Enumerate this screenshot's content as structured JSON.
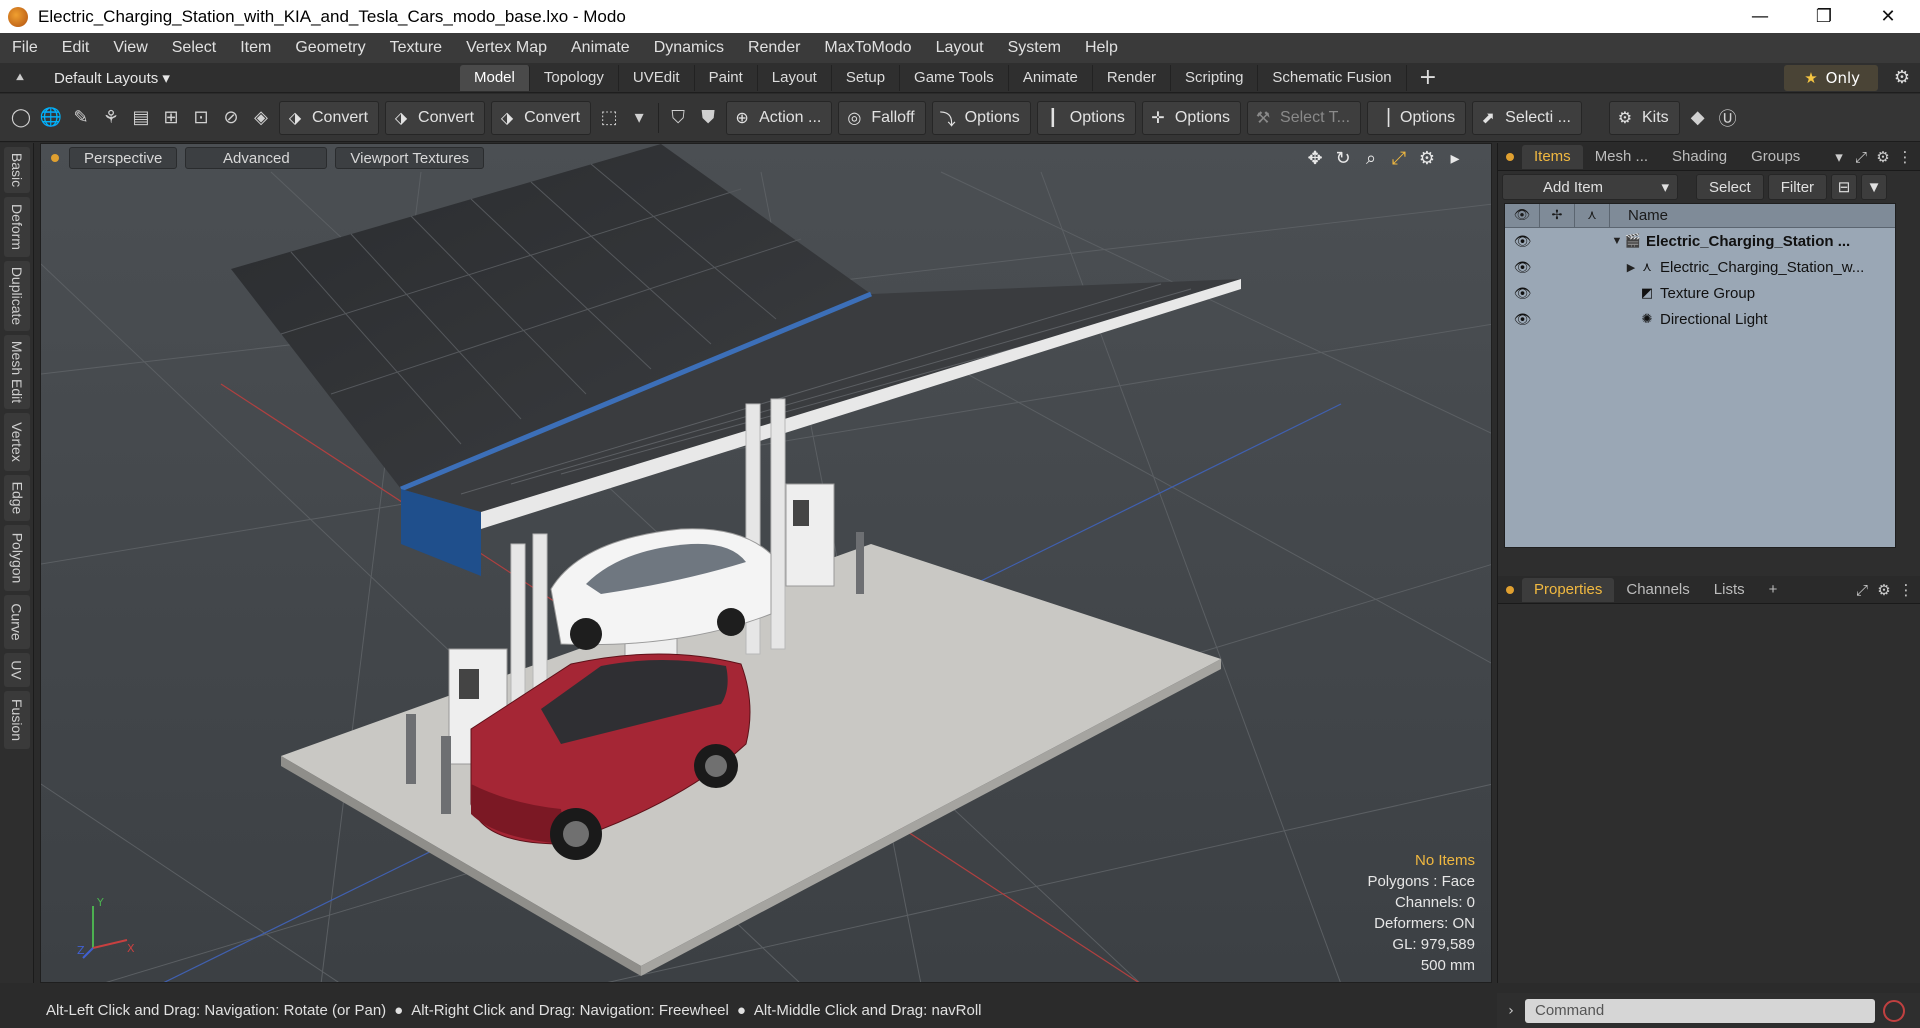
{
  "window": {
    "title": "Electric_Charging_Station_with_KIA_and_Tesla_Cars_modo_base.lxo - Modo",
    "minimize": "—",
    "maximize": "❐",
    "close": "✕"
  },
  "menu": [
    "File",
    "Edit",
    "View",
    "Select",
    "Item",
    "Geometry",
    "Texture",
    "Vertex Map",
    "Animate",
    "Dynamics",
    "Render",
    "MaxToModo",
    "Layout",
    "System",
    "Help"
  ],
  "layoutbar": {
    "layouts_label": "Default Layouts ▾",
    "tabs": [
      "Model",
      "Topology",
      "UVEdit",
      "Paint",
      "Layout",
      "Setup",
      "Game Tools",
      "Animate",
      "Render",
      "Scripting",
      "Schematic Fusion"
    ],
    "active_tab": "Model",
    "only_label": "Only"
  },
  "toolbar": {
    "convert_1": "Convert",
    "convert_2": "Convert",
    "convert_3": "Convert",
    "action": "Action ...",
    "falloff": "Falloff",
    "options_1": "Options",
    "options_2": "Options",
    "options_3": "Options",
    "select_t": "Select T...",
    "options_4": "Options",
    "selecti": "Selecti ...",
    "kits": "Kits"
  },
  "left_tabs": [
    "Basic",
    "Deform",
    "Duplicate",
    "Mesh Edit",
    "Vertex",
    "Edge",
    "Polygon",
    "Curve",
    "UV",
    "Fusion"
  ],
  "viewport": {
    "view_mode": "Perspective",
    "shading": "Advanced",
    "textures": "Viewport Textures",
    "info": {
      "selection": "No Items",
      "polygons": "Polygons : Face",
      "channels": "Channels: 0",
      "deformers": "Deformers: ON",
      "gl": "GL: 979,589",
      "unit": "500 mm"
    },
    "gizmo": {
      "x": "X",
      "y": "Y",
      "z": "Z"
    }
  },
  "items_panel": {
    "tabs": [
      "Items",
      "Mesh ...",
      "Shading",
      "Groups"
    ],
    "active_tab": "Items",
    "add_item": "Add Item",
    "select": "Select",
    "filter": "Filter",
    "name_header": "Name",
    "rows": [
      {
        "label": "Electric_Charging_Station ...",
        "icon": "scene-icon",
        "bold": true,
        "indent": 0,
        "expander": "▼"
      },
      {
        "label": "Electric_Charging_Station_w...",
        "icon": "mesh-icon",
        "bold": false,
        "indent": 1,
        "expander": "▶"
      },
      {
        "label": "Texture Group",
        "icon": "texture-group-icon",
        "bold": false,
        "indent": 1,
        "expander": ""
      },
      {
        "label": "Directional Light",
        "icon": "light-icon",
        "bold": false,
        "indent": 1,
        "expander": ""
      }
    ]
  },
  "properties_panel": {
    "tabs": [
      "Properties",
      "Channels",
      "Lists"
    ],
    "active_tab": "Properties"
  },
  "command": {
    "placeholder": "Command"
  },
  "status": {
    "hint_1": "Alt-Left Click and Drag: Navigation: Rotate (or Pan)",
    "hint_2": "Alt-Right Click and Drag: Navigation: Freewheel",
    "hint_3": "Alt-Middle Click and Drag: navRoll"
  }
}
